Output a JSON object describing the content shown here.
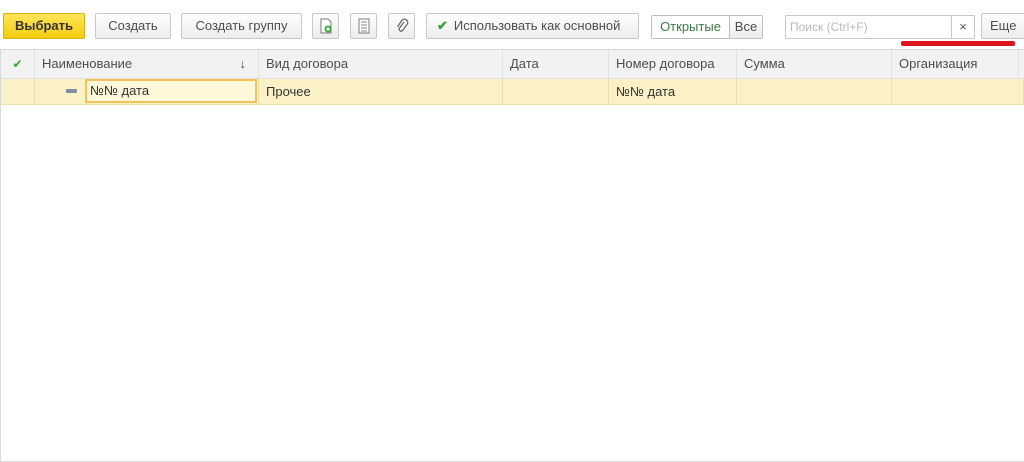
{
  "toolbar": {
    "select_label": "Выбрать",
    "create_label": "Создать",
    "create_group_label": "Создать группу",
    "use_as_main_label": "Использовать как основной",
    "filter_open_label": "Открытые",
    "filter_all_label": "Все",
    "search_placeholder": "Поиск (Ctrl+F)",
    "search_clear": "×",
    "more_label": "Еще"
  },
  "table": {
    "columns": [
      "Наименование",
      "Вид договора",
      "Дата",
      "Номер договора",
      "Сумма",
      "Организация"
    ],
    "sort_indicator": "↓",
    "rows": [
      {
        "name": "№№ дата",
        "contract_type": "Прочее",
        "date": "",
        "contract_number": "№№ дата",
        "amount": "",
        "organization": ""
      }
    ]
  },
  "colors": {
    "accent_button": "#f5cd0e",
    "selected_row": "#fbf1c6",
    "active_filter_text": "#3a7a43",
    "redaction": "#e0141c"
  }
}
